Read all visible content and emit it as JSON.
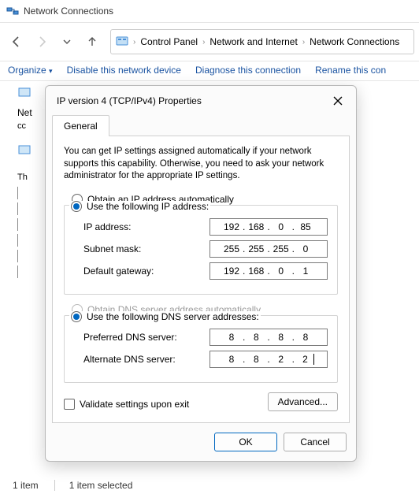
{
  "window": {
    "title": "Network Connections"
  },
  "breadcrumb": {
    "items": [
      "Control Panel",
      "Network and Internet",
      "Network Connections"
    ]
  },
  "commands": {
    "organize": "Organize",
    "disable": "Disable this network device",
    "diagnose": "Diagnose this connection",
    "rename": "Rename this con"
  },
  "background": {
    "net_label": "Net",
    "cc_label": "cc",
    "th_label": "Th"
  },
  "status": {
    "count": "1 item",
    "selected": "1 item selected"
  },
  "dialog": {
    "title": "IP version 4 (TCP/IPv4) Properties",
    "tab_general": "General",
    "description": "You can get IP settings assigned automatically if your network supports this capability. Otherwise, you need to ask your network administrator for the appropriate IP settings.",
    "radio_auto_ip": "Obtain an IP address automatically",
    "radio_manual_ip": "Use the following IP address:",
    "label_ip": "IP address:",
    "label_subnet": "Subnet mask:",
    "label_gateway": "Default gateway:",
    "ip": {
      "a": "192",
      "b": "168",
      "c": "0",
      "d": "85"
    },
    "subnet": {
      "a": "255",
      "b": "255",
      "c": "255",
      "d": "0"
    },
    "gateway": {
      "a": "192",
      "b": "168",
      "c": "0",
      "d": "1"
    },
    "radio_auto_dns": "Obtain DNS server address automatically",
    "radio_manual_dns": "Use the following DNS server addresses:",
    "label_pref_dns": "Preferred DNS server:",
    "label_alt_dns": "Alternate DNS server:",
    "pref_dns": {
      "a": "8",
      "b": "8",
      "c": "8",
      "d": "8"
    },
    "alt_dns": {
      "a": "8",
      "b": "8",
      "c": "2",
      "d": "2"
    },
    "validate": "Validate settings upon exit",
    "advanced": "Advanced...",
    "ok": "OK",
    "cancel": "Cancel"
  }
}
